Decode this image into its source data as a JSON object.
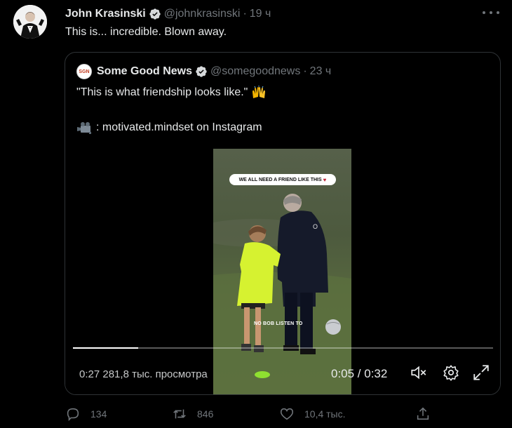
{
  "tweet": {
    "author_name": "John Krasinski",
    "handle": "@johnkrasinski",
    "separator": "·",
    "time": "19 ч",
    "text": "This is... incredible.  Blown away.",
    "avatar_icon": "person-in-suit-avatar",
    "verified_icon": "verified-badge-icon"
  },
  "quote": {
    "author_name": "Some Good News",
    "handle": "@somegoodnews",
    "separator": "·",
    "time": "23 ч",
    "avatar_text": "SGN",
    "line1": "\"This is what friendship looks like.\"",
    "line1_emoji": "raising-hands-emoji",
    "line2": ": motivated.mindset on Instagram",
    "line2_emoji": "movie-camera-emoji"
  },
  "video": {
    "caption_text": "WE ALL NEED A FRIEND LIKE THIS",
    "subtitle_text": "NO BOB LISTEN TO",
    "elapsed": "0:27",
    "views": "281,8 тыс. просмотра",
    "time_display": "0:05 / 0:32",
    "progress": 0.156,
    "mute_icon": "muted-speaker-icon",
    "settings_icon": "settings-gear-icon",
    "fullscreen_icon": "fullscreen-icon"
  },
  "actions": {
    "reply_count": "134",
    "retweet_count": "846",
    "like_count": "10,4 тыс.",
    "reply_icon": "reply-bubble-icon",
    "retweet_icon": "retweet-icon",
    "like_icon": "heart-icon",
    "share_icon": "share-icon"
  },
  "colors": {
    "background": "#000000",
    "text_primary": "#e7e9ea",
    "text_secondary": "#71767b",
    "verified": "#1d9bf0",
    "border": "#2f3336"
  }
}
